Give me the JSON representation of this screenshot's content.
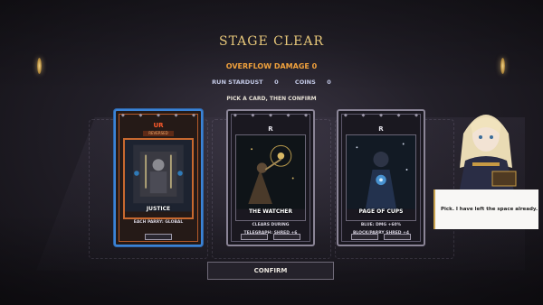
{
  "header": {
    "title": "STAGE CLEAR",
    "overflow_damage_label": "OVERFLOW DAMAGE",
    "overflow_damage_value": "0",
    "run_stardust_label": "RUN STARDUST",
    "run_stardust_value": "0",
    "coins_label": "COINS",
    "coins_value": "0",
    "prompt": "PICK A CARD, THEN CONFIRM"
  },
  "cards": [
    {
      "rarity": "UR",
      "state": "REVERSED",
      "name": "JUSTICE",
      "desc1": "EACH PARRY: GLOBAL",
      "desc2": "",
      "selected": true
    },
    {
      "rarity": "R",
      "state": "",
      "name": "THE WATCHER",
      "desc1": "CLEARS DURING",
      "desc2": "TELEGRAPH: SHRED +6",
      "selected": false
    },
    {
      "rarity": "R",
      "state": "",
      "name": "PAGE OF CUPS",
      "desc1": "BLUE: DMG +60%",
      "desc2": "BLOCK/PARRY SHRED +4",
      "selected": false
    }
  ],
  "confirm_label": "CONFIRM",
  "dialogue": "Pick. I have left the space already.",
  "colors": {
    "accent_gold": "#e7c77a",
    "overflow_orange": "#f1a13c",
    "selected_blue": "#3b83d6",
    "ur_red": "#ff5a2b"
  },
  "icons": [
    "crystal-gem-icon",
    "card-corner-ornament-icon"
  ]
}
